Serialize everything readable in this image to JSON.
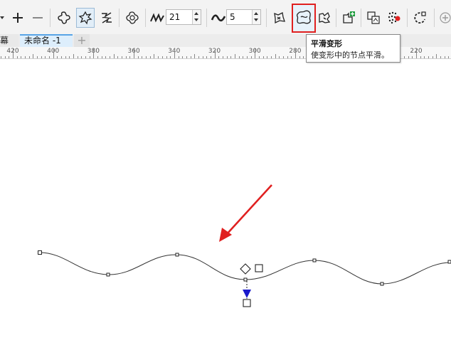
{
  "toolbar": {
    "frequency_value": "21",
    "amplitude_value": "5"
  },
  "tabs": {
    "partial_label": "幕",
    "document_label": "未命名 -1",
    "add_label": "+"
  },
  "ruler": {
    "labels": [
      "420",
      "400",
      "380",
      "360",
      "340",
      "320",
      "300",
      "280",
      "260",
      "240",
      "220"
    ]
  },
  "tooltip": {
    "title": "平滑变形",
    "description": "使变形中的节点平滑。"
  },
  "colors": {
    "highlight": "#e02020",
    "arrow": "#e02020",
    "handle": "#1a1acc"
  },
  "icons": {
    "highlighted": "smooth-distortion-icon"
  }
}
